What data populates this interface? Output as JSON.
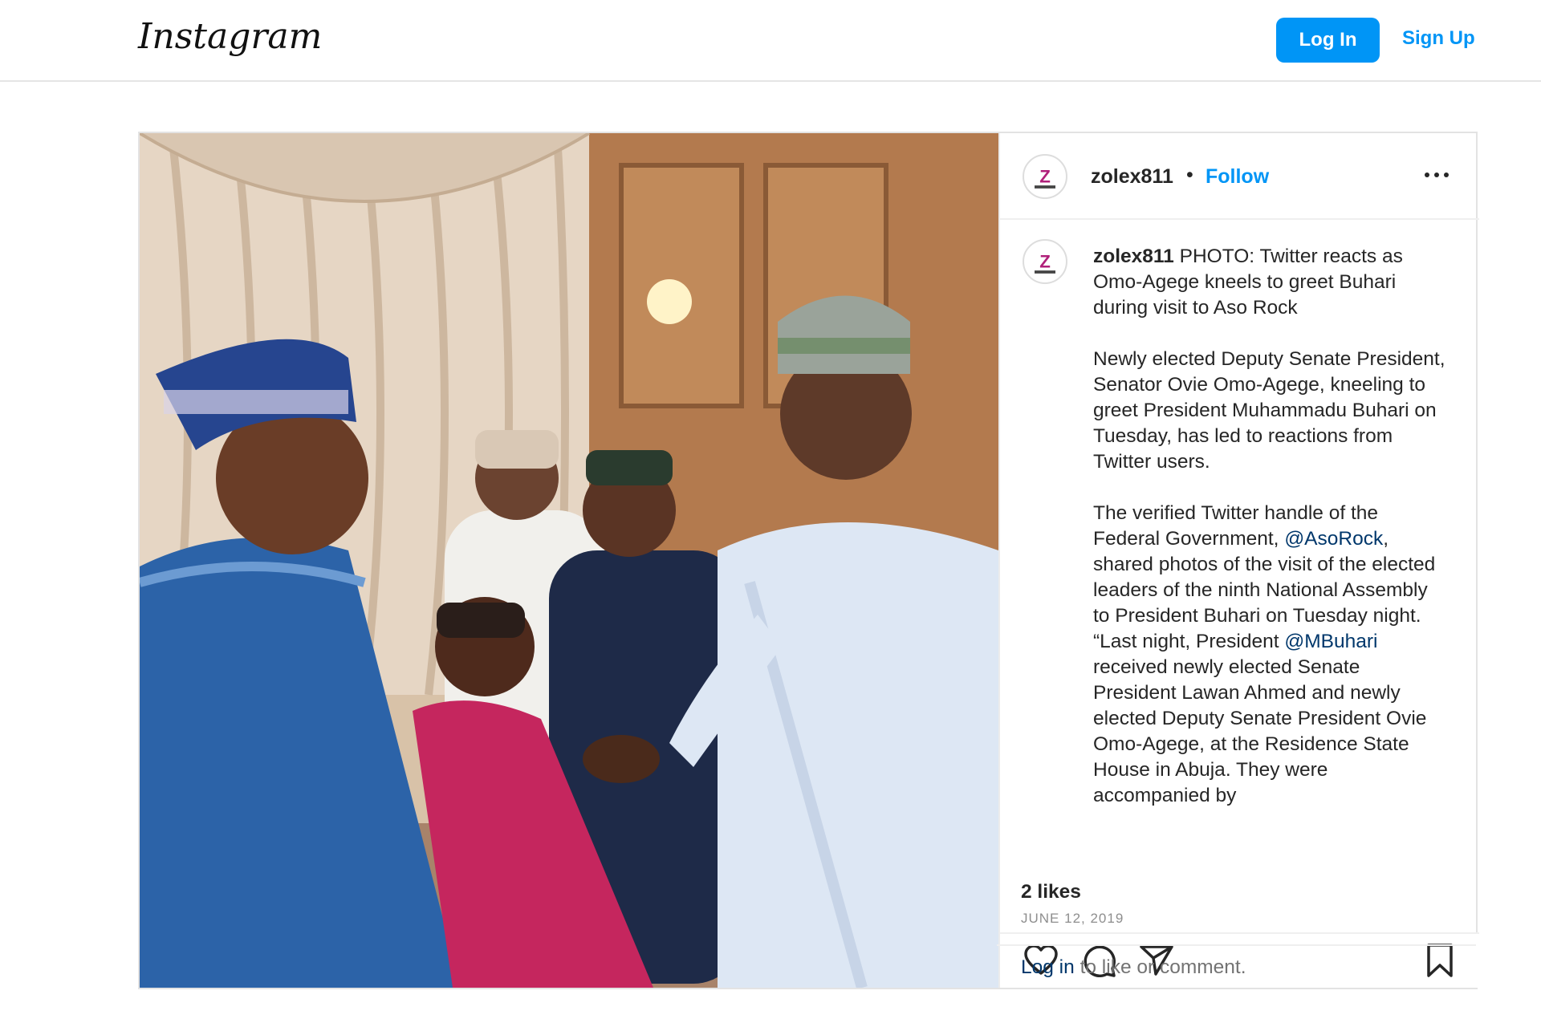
{
  "header": {
    "logo_text": "Instagram",
    "login_label": "Log In",
    "signup_label": "Sign Up"
  },
  "post": {
    "username": "zolex811",
    "separator": "•",
    "follow_label": "Follow",
    "caption": {
      "username": "zolex811",
      "headline": "PHOTO: Twitter reacts as Omo-Agege kneels to greet Buhari during visit to Aso Rock",
      "para2": "Newly elected Deputy Senate President, Senator Ovie Omo-Agege, kneeling to greet President Muhammadu Buhari on Tuesday, has led to reactions from Twitter users.",
      "para3_a": "The verified Twitter handle of the Federal Government, ",
      "mention1": "@AsoRock",
      "para3_b": ", shared photos of the visit of the elected leaders of the ninth National Assembly to President Buhari on Tuesday night. “Last night, President ",
      "mention2": "@MBuhari",
      "para3_c": " received newly elected Senate President Lawan Ahmed and newly elected Deputy Senate President Ovie Omo-Agege, at the Residence State House in Abuja. They were accompanied by"
    },
    "likes": "2 likes",
    "date": "JUNE 12, 2019",
    "login_link": "Log in",
    "login_suffix": " to like or comment."
  },
  "icons": {
    "like": "heart-icon",
    "comment": "comment-icon",
    "share": "share-icon",
    "save": "bookmark-icon",
    "more": "more-icon"
  },
  "colors": {
    "primary_blue": "#0095f6",
    "mention_blue": "#00376b"
  }
}
